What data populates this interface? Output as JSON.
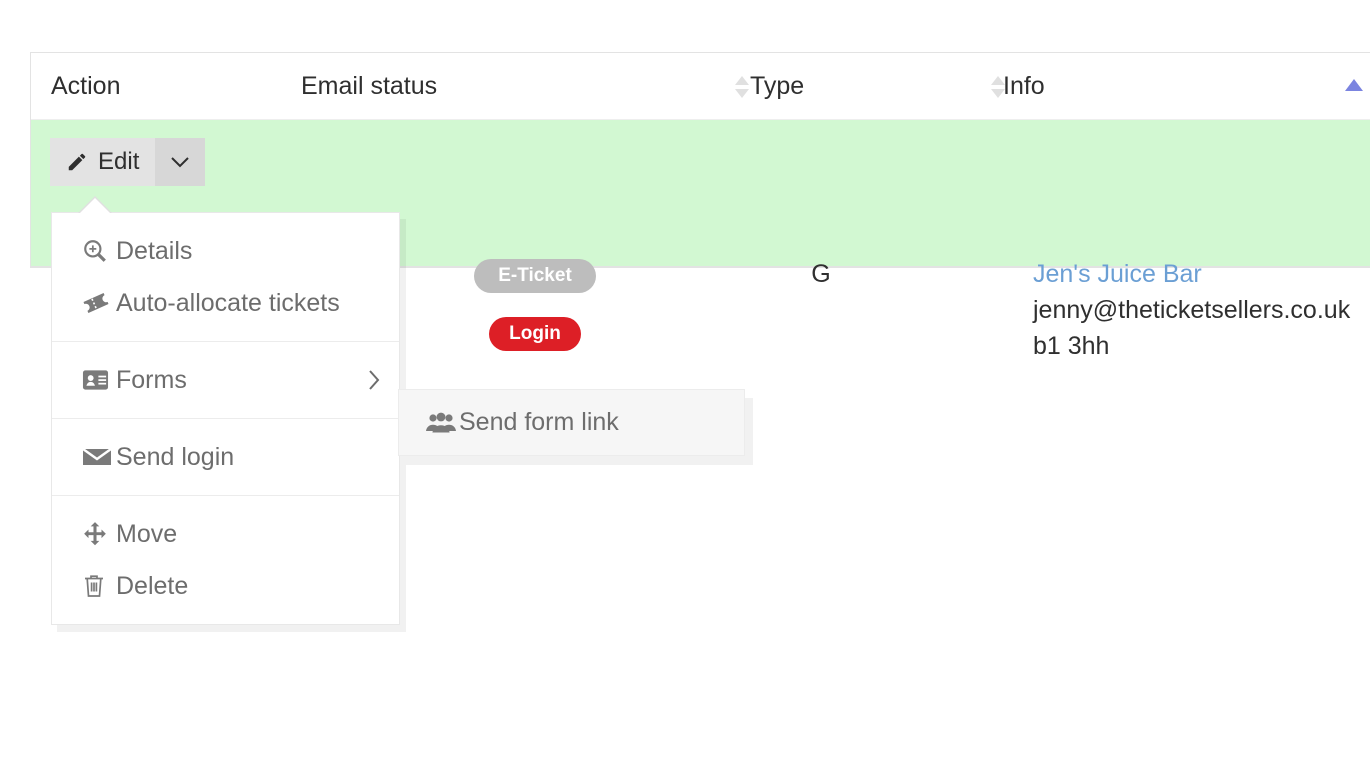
{
  "table": {
    "headers": [
      {
        "id": "action",
        "label": "Action",
        "sortable": false
      },
      {
        "id": "email_status",
        "label": "Email status",
        "sortable": true
      },
      {
        "id": "type",
        "label": "Type",
        "sortable": true
      },
      {
        "id": "info",
        "label": "Info",
        "sortable": true,
        "sort_state": "asc"
      }
    ],
    "rows": [
      {
        "highlight_color": "#d2f8d2",
        "action": {
          "edit_label": "Edit",
          "edit_icon": "pencil-icon",
          "caret_icon": "chevron-down-icon"
        },
        "email_status": {
          "badges": [
            {
              "label": "E-Ticket",
              "color": "#bdbdbd"
            },
            {
              "label": "Login",
              "color": "#dd1f26"
            }
          ]
        },
        "type": "G",
        "info": {
          "name": "Jen's Juice Bar",
          "name_color": "#6b9fd4",
          "email": "jenny@theticketsellers.co.uk",
          "postcode": "b1 3hh"
        }
      }
    ]
  },
  "dropdown_menu": {
    "open": true,
    "groups": [
      {
        "items": [
          {
            "label": "Details",
            "icon": "search-plus-icon",
            "has_submenu": false
          },
          {
            "label": "Auto-allocate tickets",
            "icon": "ticket-icon",
            "has_submenu": false
          }
        ]
      },
      {
        "items": [
          {
            "label": "Forms",
            "icon": "id-card-icon",
            "has_submenu": true,
            "submenu_arrow": "chevron-right-icon"
          }
        ]
      },
      {
        "items": [
          {
            "label": "Send login",
            "icon": "envelope-icon",
            "has_submenu": false
          }
        ]
      },
      {
        "items": [
          {
            "label": "Move",
            "icon": "arrows-move-icon",
            "has_submenu": false
          },
          {
            "label": "Delete",
            "icon": "trash-icon",
            "has_submenu": false
          }
        ]
      }
    ]
  },
  "submenu": {
    "open": true,
    "parent": "Forms",
    "items": [
      {
        "label": "Send form link",
        "icon": "users-icon"
      }
    ]
  },
  "colors": {
    "row_highlight": "#d2f8d2",
    "badge_gray": "#bdbdbd",
    "badge_red": "#dd1f26",
    "link_blue": "#6b9fd4",
    "sort_active": "#7b84e0",
    "menu_text": "#6d6d6d"
  }
}
